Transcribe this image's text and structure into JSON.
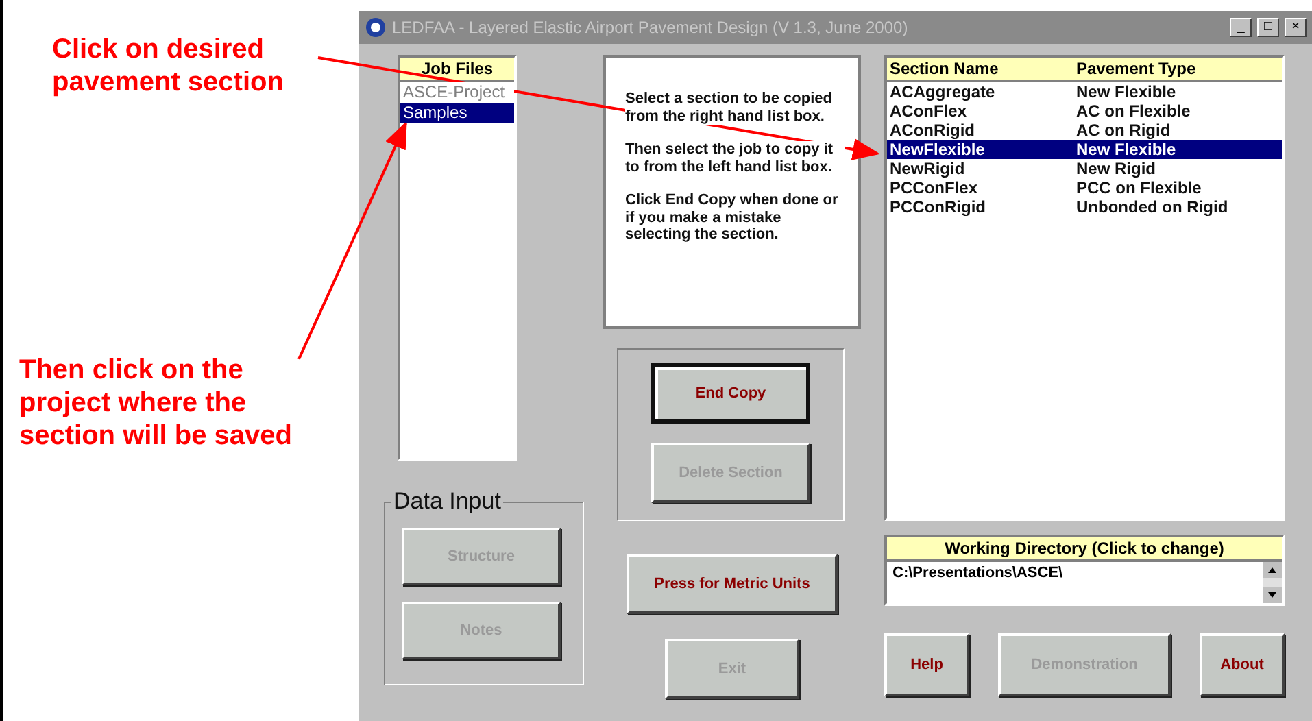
{
  "annotations": [
    {
      "text": "Click on desired pavement section"
    },
    {
      "text": "Then click on the project where the section will be saved"
    }
  ],
  "window": {
    "title": "LEDFAA - Layered Elastic Airport Pavement Design (V 1.3, June 2000)",
    "controls": [
      "_",
      "□",
      "×"
    ]
  },
  "job_files": {
    "header": "Job Files",
    "items": [
      {
        "label": "ASCE-Project",
        "selected": false
      },
      {
        "label": "Samples",
        "selected": true
      }
    ]
  },
  "instructions": [
    "Select a section to be copied from the right hand list box.",
    "Then select the job to copy it to from the left hand list box.",
    "Click End Copy when done or if you make a mistake selecting the section."
  ],
  "copy_buttons": [
    {
      "label": "End Copy",
      "disabled": false,
      "default": true
    },
    {
      "label": "Delete Section",
      "disabled": true,
      "default": false
    }
  ],
  "data_input": {
    "title": "Data Input",
    "buttons": [
      {
        "label": "Structure",
        "disabled": true
      },
      {
        "label": "Notes",
        "disabled": true
      }
    ]
  },
  "metric_button": {
    "label": "Press for Metric Units",
    "disabled": false
  },
  "exit_button": {
    "label": "Exit",
    "disabled": true
  },
  "sections": {
    "columns": [
      "Section Name",
      "Pavement Type"
    ],
    "rows": [
      {
        "name": "ACAggregate",
        "type": "New Flexible",
        "selected": false
      },
      {
        "name": "AConFlex",
        "type": "AC on Flexible",
        "selected": false
      },
      {
        "name": "AConRigid",
        "type": "AC on Rigid",
        "selected": false
      },
      {
        "name": "NewFlexible",
        "type": "New Flexible",
        "selected": true
      },
      {
        "name": "NewRigid",
        "type": "New Rigid",
        "selected": false
      },
      {
        "name": "PCConFlex",
        "type": "PCC on Flexible",
        "selected": false
      },
      {
        "name": "PCConRigid",
        "type": "Unbonded on Rigid",
        "selected": false
      }
    ]
  },
  "working_directory": {
    "header": "Working Directory (Click to change)",
    "value": "C:\\Presentations\\ASCE\\"
  },
  "bottom_buttons": [
    {
      "label": "Help",
      "disabled": false
    },
    {
      "label": "Demonstration",
      "disabled": true
    },
    {
      "label": "About",
      "disabled": false
    }
  ]
}
